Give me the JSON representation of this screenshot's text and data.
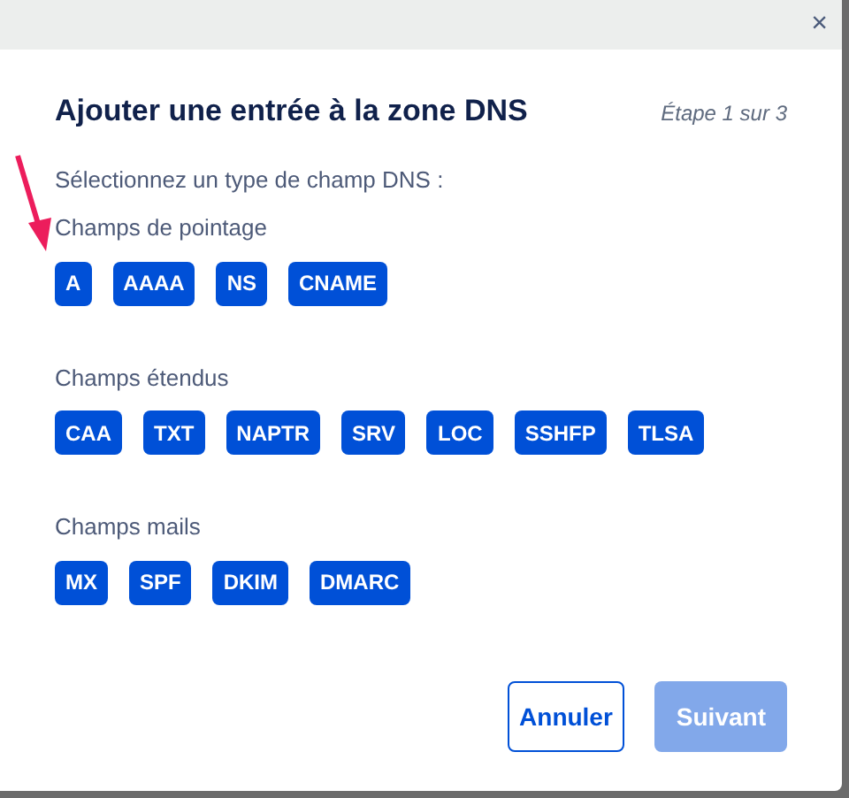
{
  "dialog": {
    "close": "×",
    "title": "Ajouter une entrée à la zone DNS",
    "step": "Étape 1 sur 3",
    "prompt": "Sélectionnez un type de champ DNS :"
  },
  "groups": [
    {
      "label": "Champs de pointage",
      "types": [
        "A",
        "AAAA",
        "NS",
        "CNAME"
      ]
    },
    {
      "label": "Champs étendus",
      "types": [
        "CAA",
        "TXT",
        "NAPTR",
        "SRV",
        "LOC",
        "SSHFP",
        "TLSA"
      ]
    },
    {
      "label": "Champs mails",
      "types": [
        "MX",
        "SPF",
        "DKIM",
        "DMARC"
      ]
    }
  ],
  "buttons": [
    {
      "label": "Annuler",
      "kind": "secondary",
      "disabled": false
    },
    {
      "label": "Suivant",
      "kind": "primary",
      "disabled": true
    }
  ]
}
